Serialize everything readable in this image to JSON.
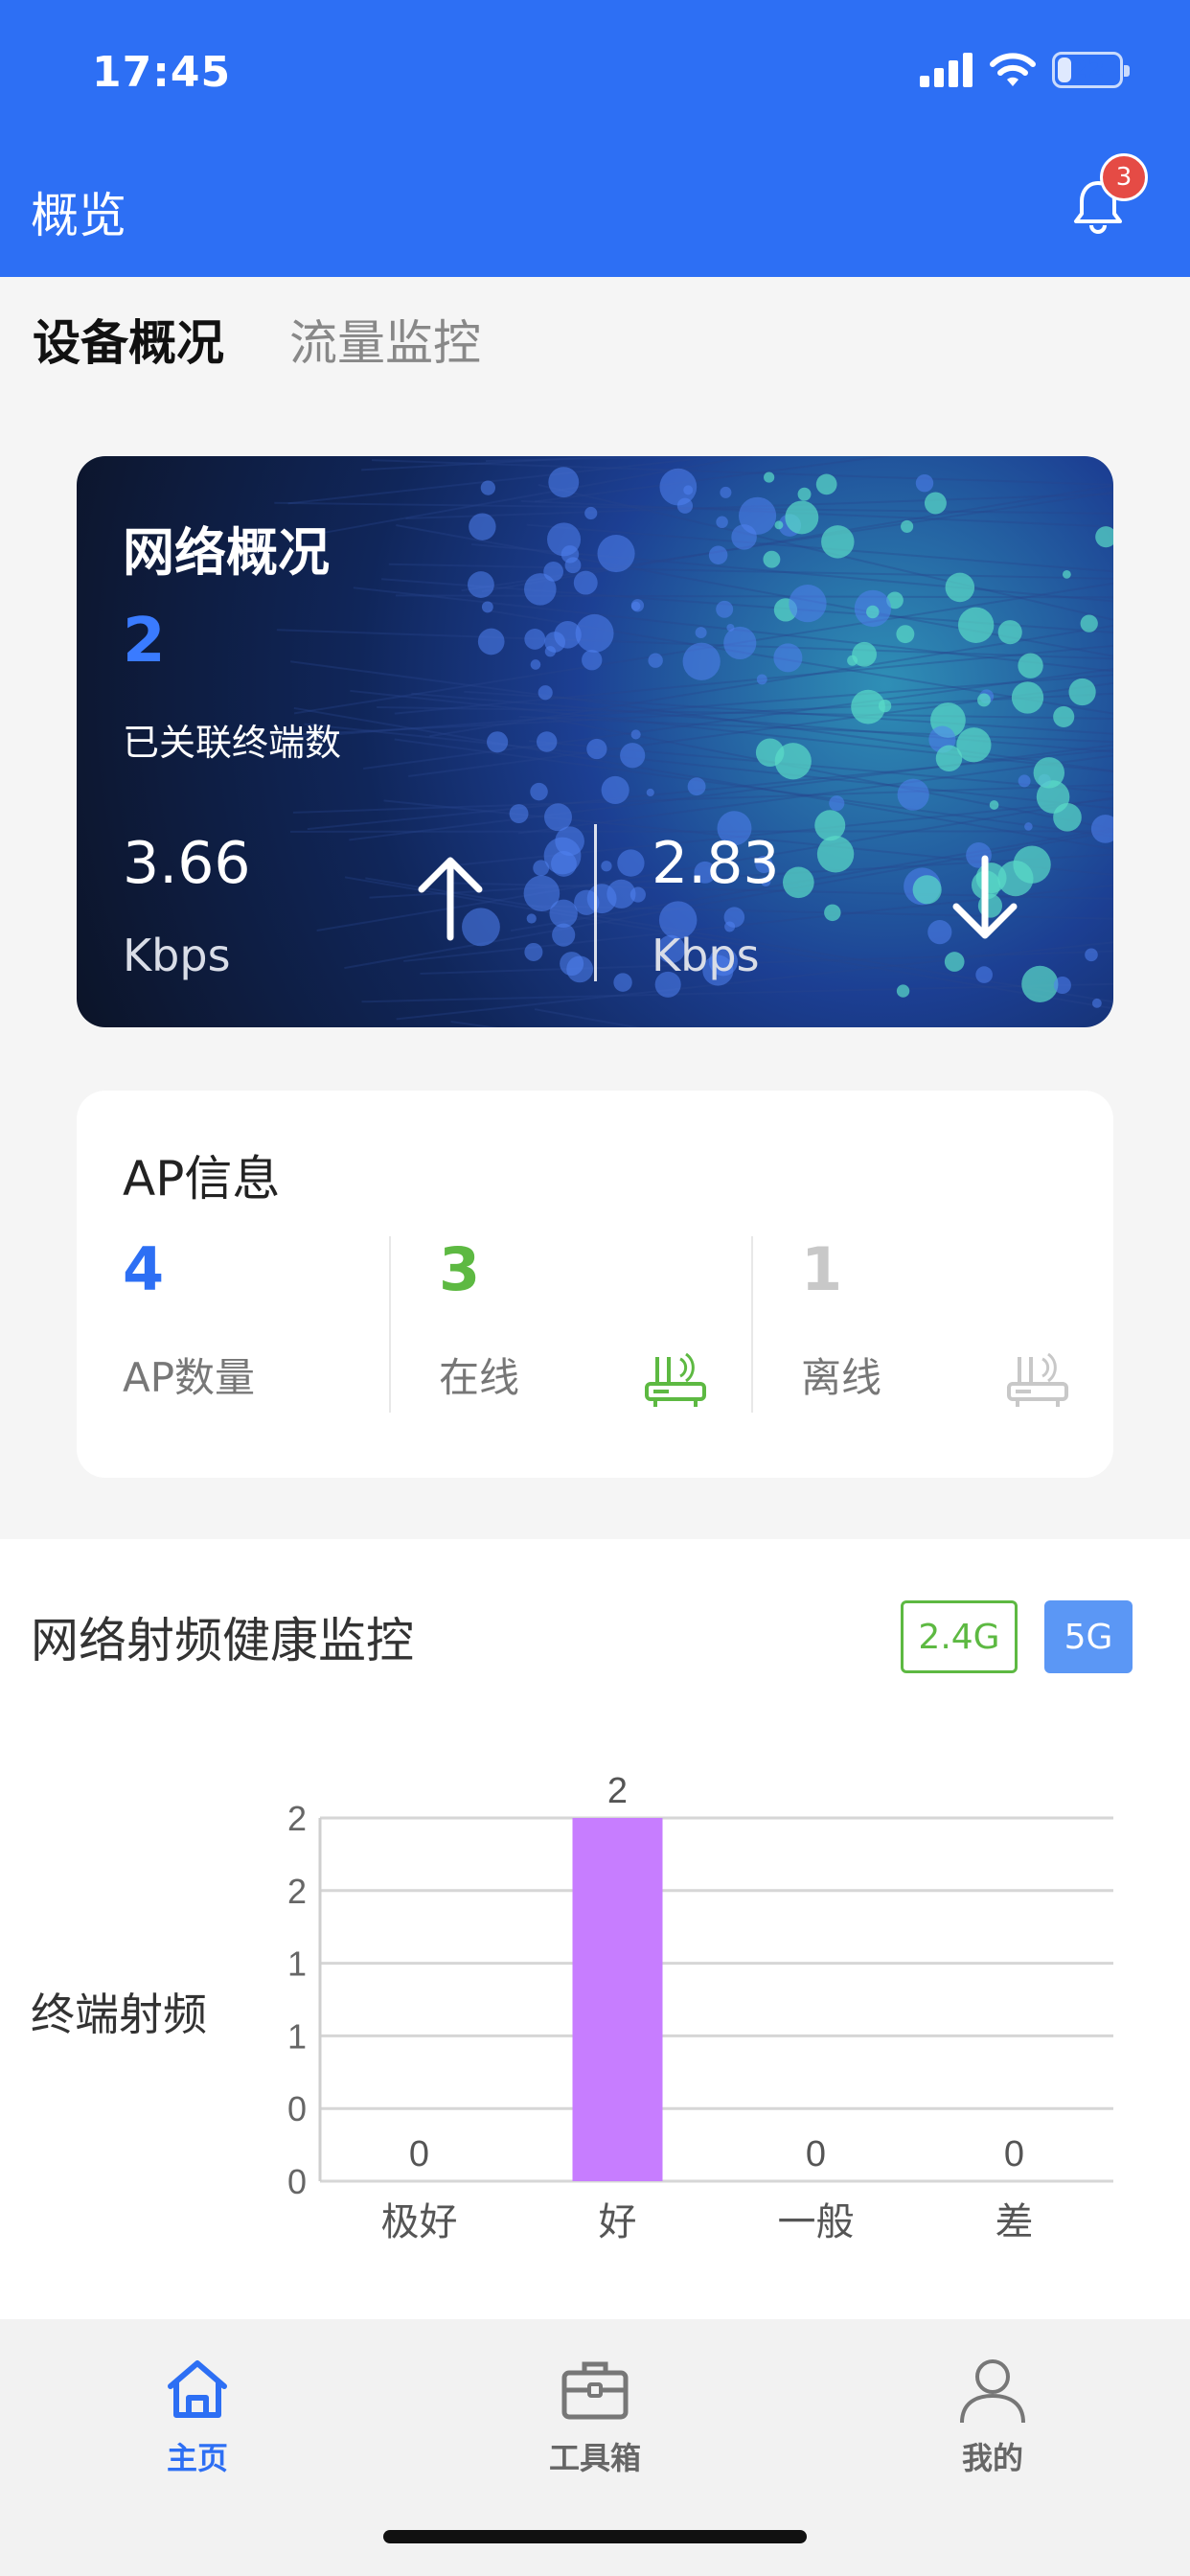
{
  "status_bar": {
    "time": "17:45",
    "battery": "22",
    "battery_level": 0.22
  },
  "header": {
    "title": "概览",
    "notification_count": "3"
  },
  "tabs": [
    {
      "label": "设备概况",
      "active": true
    },
    {
      "label": "流量监控",
      "active": false
    }
  ],
  "network_overview": {
    "title": "网络概况",
    "connected_count": "2",
    "connected_label": "已关联终端数",
    "upload": {
      "value": "3.66",
      "unit": "Kbps"
    },
    "download": {
      "value": "2.83",
      "unit": "Kbps"
    }
  },
  "ap_info": {
    "title": "AP信息",
    "total": {
      "value": "4",
      "label": "AP数量",
      "color": "#2d6ff4"
    },
    "online": {
      "value": "3",
      "label": "在线",
      "color": "#5db942"
    },
    "offline": {
      "value": "1",
      "label": "离线",
      "color": "#c8c8c8"
    }
  },
  "health": {
    "title": "网络射频健康监控",
    "band_24": "2.4G",
    "band_5": "5G",
    "row_label": "终端射频"
  },
  "chart_data": {
    "type": "bar",
    "categories": [
      "极好",
      "好",
      "一般",
      "差"
    ],
    "values": [
      0,
      2,
      0,
      0
    ],
    "data_labels": [
      "0",
      "2",
      "0",
      "0"
    ],
    "ytick_labels": [
      "0",
      "0",
      "1",
      "1",
      "2",
      "2"
    ],
    "ylim": [
      0,
      2
    ],
    "bar_color": "#c77dff",
    "grid": true
  },
  "tabbar": [
    {
      "label": "主页",
      "icon": "home-icon",
      "active": true
    },
    {
      "label": "工具箱",
      "icon": "toolbox-icon",
      "active": false
    },
    {
      "label": "我的",
      "icon": "user-icon",
      "active": false
    }
  ],
  "colors": {
    "primary": "#2d6ff4",
    "online": "#5db942",
    "offline": "#c8c8c8",
    "badge": "#e54b45"
  }
}
